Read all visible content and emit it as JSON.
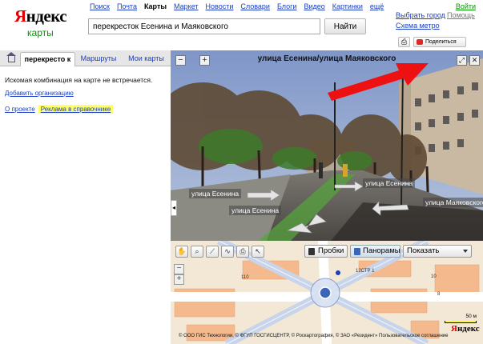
{
  "header": {
    "logo_brand_first": "Я",
    "logo_brand_rest": "ндекс",
    "logo_service": "карты",
    "nav": [
      "Поиск",
      "Почта",
      "Карты",
      "Маркет",
      "Новости",
      "Словари",
      "Блоги",
      "Видео",
      "Картинки",
      "ещё"
    ],
    "nav_active": "Карты",
    "login": "Войти",
    "search_value": "перекресток Есенина и Маяковского",
    "search_button": "Найти",
    "city_link": "Выбрать город",
    "help_link": "Помощь",
    "metro_link": "Схема метро",
    "share_button": "Поделиться"
  },
  "left_panel": {
    "tabs": {
      "search": "перекресто к",
      "routes": "Маршруты",
      "my_maps": "Мои карты"
    },
    "not_found_text": "Искомая комбинация на карте не встречается.",
    "add_org_link": "Добавить организацию",
    "about_link": "О проекте",
    "ads_link": "Реклама в справочнике"
  },
  "panorama": {
    "title": "улица Есенина/улица Маяковского",
    "zoom_out": "−",
    "zoom_in": "+",
    "collapse": "◂",
    "street_labels": {
      "esenina_left": "улица Есенина",
      "esenina_right": "улица Есенина",
      "esenina_bottom": "улица Есенина",
      "mayakovskogo": "улица Маяковского"
    }
  },
  "map": {
    "traffic_button": "Пробки",
    "panorama_button": "Панорамы",
    "show_select": "Показать",
    "zoom_out": "−",
    "zoom_in": "+",
    "labels": {
      "building_110": "110",
      "building_12str1": "12СТР 1",
      "building_10": "10",
      "building_8": "8"
    },
    "scale": "50 м",
    "logo_first": "Я",
    "logo_rest": "ндекс",
    "copyright": "© ООО ГИС Технологии, © ФГУП ГОСГИСЦЕНТР, © Роскартография, © ЗАО «Резидент»  Пользовательское соглашение"
  },
  "colors": {
    "link": "#1a3dc1",
    "service_green": "#009900",
    "brand_red": "#e10000",
    "ads_highlight": "#ffff66",
    "annotation_arrow": "#ee1111"
  }
}
